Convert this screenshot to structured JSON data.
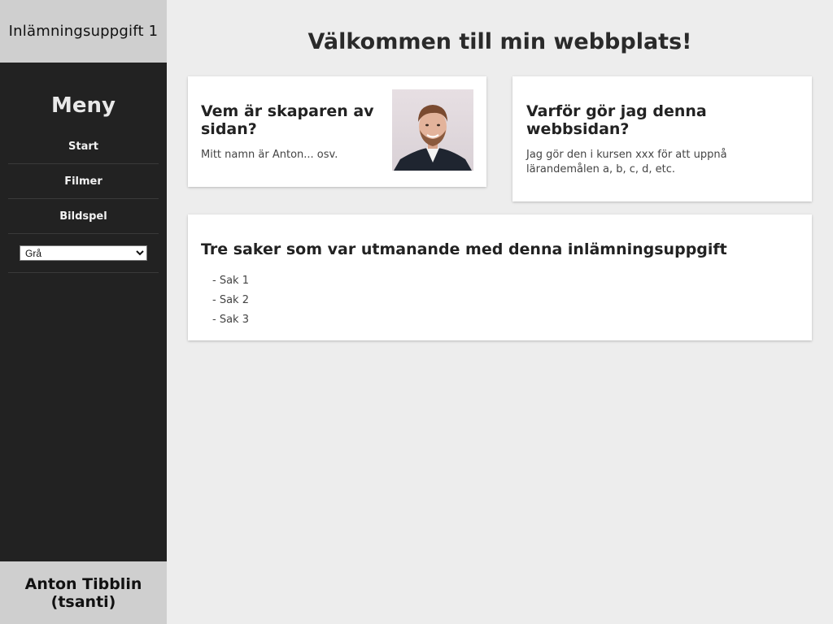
{
  "sidebar": {
    "site_title": "Inlämningsuppgift 1",
    "menu_heading": "Meny",
    "nav": [
      {
        "label": "Start"
      },
      {
        "label": "Filmer"
      },
      {
        "label": "Bildspel"
      }
    ],
    "theme_select": {
      "selected": "Grå"
    },
    "author": {
      "line1": "Anton Tibblin",
      "line2": "(tsanti)"
    }
  },
  "main": {
    "title": "Välkommen till min webbplats!",
    "about": {
      "heading": "Vem är skaparen av sidan?",
      "text": "Mitt namn är Anton... osv."
    },
    "why": {
      "heading": "Varför gör jag denna webbsidan?",
      "text": "Jag gör den i kursen xxx för att uppnå lärandemålen a, b, c, d, etc."
    },
    "challenges": {
      "heading": "Tre saker som var utmanande med denna inlämningsuppgift",
      "items": [
        "- Sak 1",
        "- Sak 2",
        "- Sak 3"
      ]
    }
  }
}
